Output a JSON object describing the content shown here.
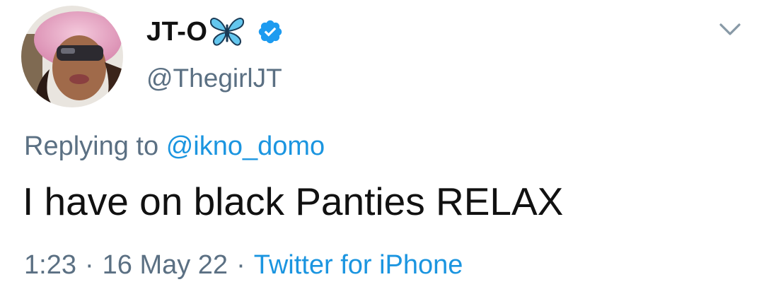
{
  "tweet": {
    "author": {
      "display_name": "JT-O",
      "name_emoji": "butterfly-icon",
      "verified": true,
      "handle": "@ThegirlJT",
      "avatar_icon": "avatar"
    },
    "reply": {
      "prefix": "Replying to",
      "mention": "@ikno_domo"
    },
    "text": "I have on black Panties RELAX",
    "time": "1:23",
    "date": "16 May 22",
    "separator": "·",
    "source": "Twitter for iPhone",
    "menu_icon": "chevron-down-icon"
  },
  "colors": {
    "text_primary": "#111111",
    "text_secondary": "#5b7083",
    "link": "#1b95e0",
    "verified_badge": "#1d9bf0",
    "butterfly": "#63c6ee"
  }
}
